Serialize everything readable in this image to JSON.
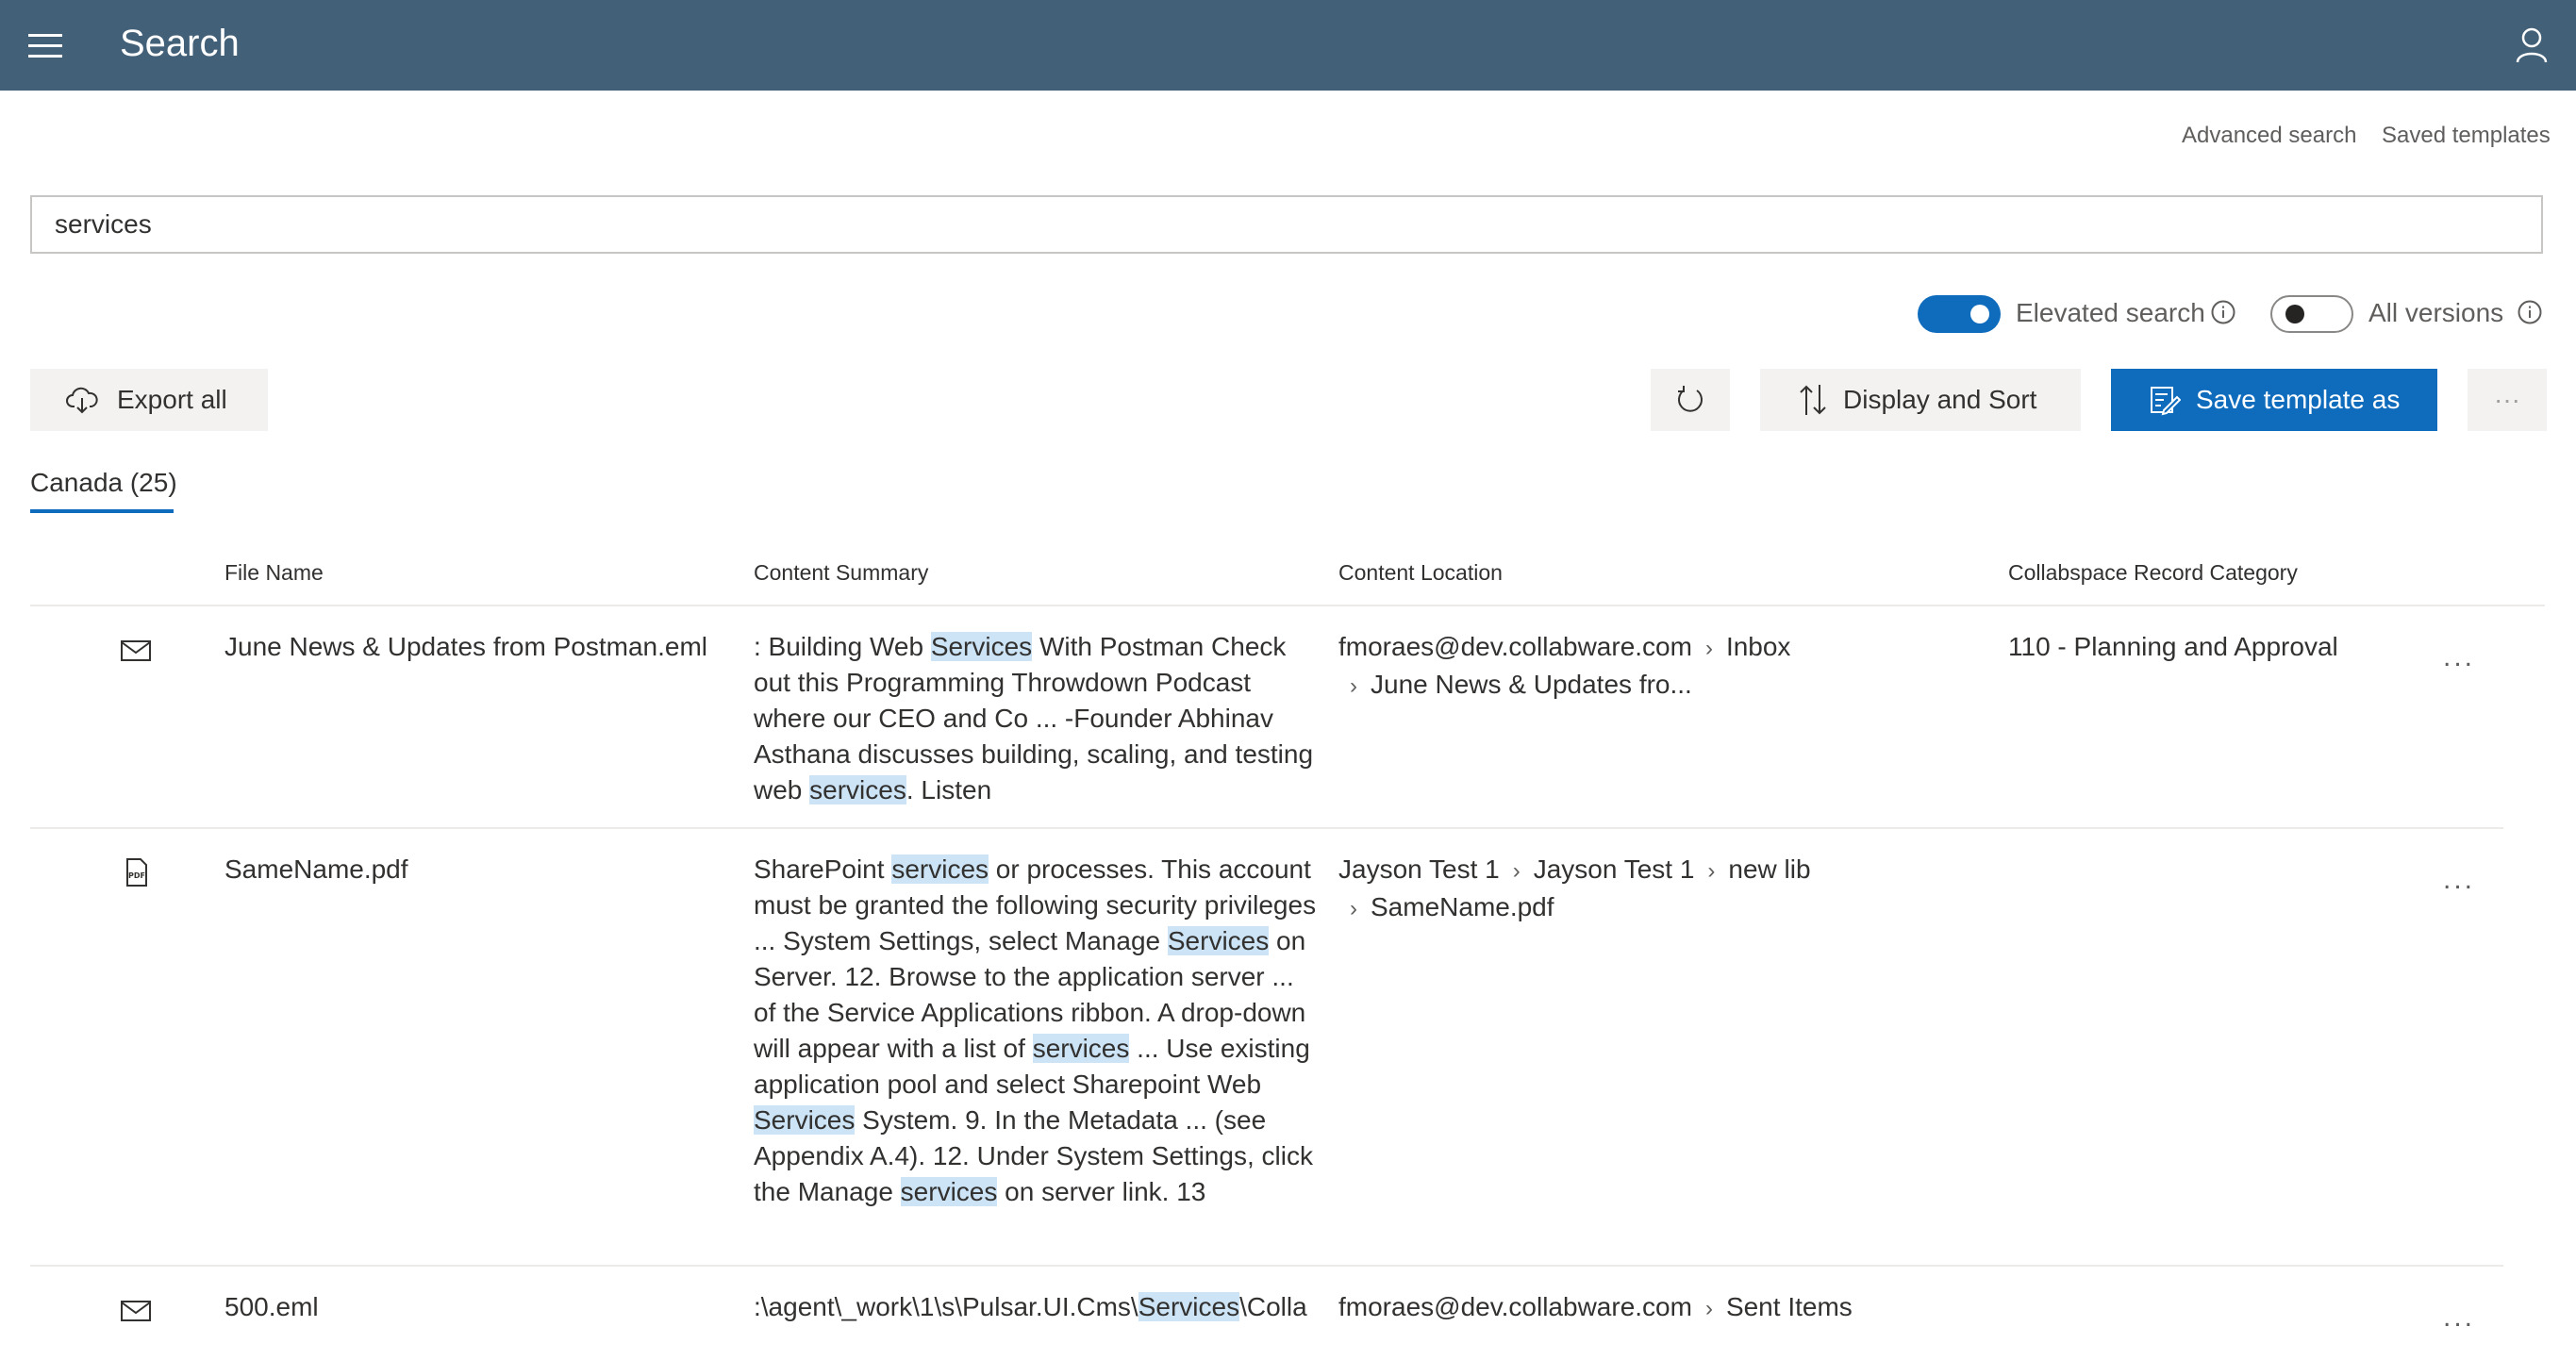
{
  "header": {
    "title": "Search"
  },
  "links": {
    "advanced": "Advanced search",
    "saved": "Saved templates"
  },
  "search": {
    "value": "services"
  },
  "toggles": {
    "elevated_label": "Elevated search",
    "versions_label": "All versions"
  },
  "toolbar": {
    "export_label": "Export all",
    "display_sort_label": "Display and Sort",
    "save_template_label": "Save template as",
    "more_label": "···"
  },
  "tab": {
    "label": "Canada (25)"
  },
  "columns": {
    "file_name": "File Name",
    "summary": "Content Summary",
    "location": "Content Location",
    "category": "Collabspace Record Category"
  },
  "rows": [
    {
      "icon": "mail-icon",
      "file_name": "June News & Updates from Postman.eml",
      "summary_html": ": Building Web <span class=\"hl\">Services</span> With Postman Check out this Programming Throwdown Podcast where our CEO and Co ... -Founder Abhinav Asthana discusses building, scaling, and testing web <span class=\"hl\">services</span>. Listen",
      "location": [
        [
          "fmoraes@dev.collabware.com",
          "Inbox"
        ],
        [
          "June News & Updates fro..."
        ]
      ],
      "category": "110 - Planning and Approval"
    },
    {
      "icon": "pdf-icon",
      "file_name": "SameName.pdf",
      "summary_html": "SharePoint <span class=\"hl\">services</span> or processes. This account must be granted the following security privileges ...  System Settings, select Manage <span class=\"hl\">Services</span> on Server. 12. Browse to the application server ...  of the Service Applications ribbon. A drop-down will appear with a list of <span class=\"hl\">services</span> ...  Use existing application pool and select Sharepoint Web <span class=\"hl\">Services</span> System. 9. In the Metadata ...  (see Appendix A.4). 12. Under System Settings, click the Manage <span class=\"hl\">services</span> on server link. 13",
      "location": [
        [
          "Jayson Test 1",
          "Jayson Test 1",
          "new lib"
        ],
        [
          "SameName.pdf"
        ]
      ],
      "category": ""
    },
    {
      "icon": "mail-icon",
      "file_name": "500.eml",
      "summary_html": ":\\agent\\_work\\1\\s\\Pulsar.UI.Cms\\<span class=\"hl\">Services</span>\\Colla",
      "location": [
        [
          "fmoraes@dev.collabware.com",
          "Sent Items"
        ]
      ],
      "category": ""
    }
  ]
}
